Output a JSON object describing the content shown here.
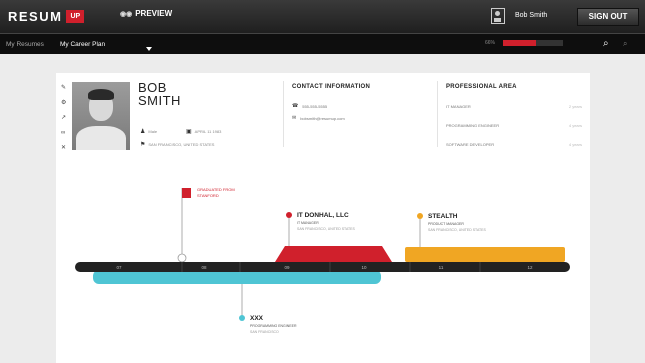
{
  "topbar": {
    "logo_text": "RESUM",
    "logo_box": "UP",
    "preview_label": "PREVIEW",
    "preview_icon": "eye-icon",
    "user_icon": "user-card-icon",
    "username": "Bob Smith",
    "signout_label": "SIGN OUT"
  },
  "subbar": {
    "tabs": [
      {
        "label": "My Resumes"
      },
      {
        "label": "My Career Plan"
      }
    ],
    "progress_label": "66%",
    "progress_value": 0.55,
    "search_icon": "search-icon",
    "zoom_icon": "zoom-icon"
  },
  "profile": {
    "first_name": "BOB",
    "last_name": "SMITH",
    "info": {
      "gender": "Male",
      "birthdate": "APRIL 11 1983",
      "location": "SAN FRANCISCO, UNITED STATES"
    },
    "contact": {
      "heading": "CONTACT INFORMATION",
      "phone": "555-555-5555",
      "email": "bobsmith@resumup.com"
    },
    "professional": {
      "heading": "PROFESSIONAL AREA",
      "rows": [
        {
          "label": "IT MANAGER",
          "value": "2 years"
        },
        {
          "label": "PROGRAMMING ENGINEER",
          "value": "4 years"
        },
        {
          "label": "SOFTWARE DEVELOPER",
          "value": "4 years"
        }
      ]
    }
  },
  "timeline": {
    "colors": {
      "red": "#d0202c",
      "orange": "#f0a623",
      "cyan": "#4fc5d4",
      "track": "#222222"
    },
    "years": [
      "07",
      "08",
      "09",
      "10",
      "11",
      "12"
    ],
    "flag": {
      "line1": "GRADUATED FROM",
      "line2": "STANFORD"
    },
    "jobs": [
      {
        "title": "IT DONHAL, LLC",
        "subtitle": "IT MANAGER",
        "detail": "SAN FRANCISCO, UNITED STATES",
        "color": "red"
      },
      {
        "title": "STEALTH",
        "subtitle": "PRODUCT MANAGER",
        "detail": "SAN FRANCISCO, UNITED STATES",
        "color": "orange"
      },
      {
        "title": "XXX",
        "subtitle": "PROGRAMMING ENGINEER",
        "detail": "SAN FRANCISCO",
        "color": "cyan"
      }
    ]
  }
}
